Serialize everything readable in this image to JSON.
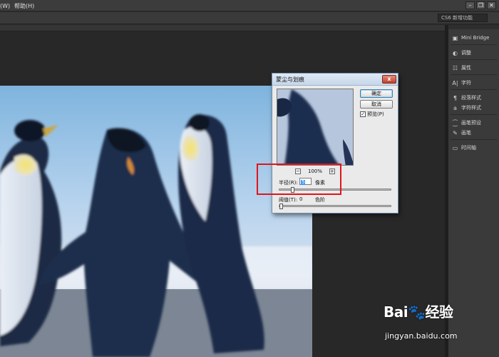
{
  "menubar": {
    "items": [
      "窗口(W)",
      "帮助(H)"
    ],
    "window_buttons": [
      "–",
      "❐",
      "✕"
    ]
  },
  "optbar": {
    "workspace": "CS6 新增功能"
  },
  "panel": {
    "items": [
      {
        "label": "Mini Bridge",
        "icon": "mini-bridge-icon"
      },
      {
        "label": "调整",
        "icon": "adjustments-icon"
      },
      {
        "label": "属性",
        "icon": "properties-icon"
      },
      {
        "label": "字符",
        "icon": "character-icon"
      },
      {
        "label": "段落样式",
        "icon": "paragraph-styles-icon"
      },
      {
        "label": "字符样式",
        "icon": "character-styles-icon"
      },
      {
        "label": "画笔预设",
        "icon": "brush-presets-icon"
      },
      {
        "label": "画笔",
        "icon": "brush-icon"
      },
      {
        "label": "时间轴",
        "icon": "timeline-icon"
      }
    ]
  },
  "dialog": {
    "title": "蒙尘与划痕",
    "close": "x",
    "ok": "确定",
    "cancel": "取消",
    "preview_label": "预览(P)",
    "preview_checked": true,
    "zoom_minus": "−",
    "zoom_plus": "+",
    "zoom": "100%",
    "radius_label": "半径(R):",
    "radius_value": "5",
    "radius_unit": "像素",
    "radius_slider_fraction": 0.05,
    "threshold_label": "阈值(T):",
    "threshold_value": "0",
    "threshold_unit": "色阶",
    "threshold_slider_fraction": 0.0
  },
  "watermark": {
    "brand": "Bai🐾经验",
    "url": "jingyan.baidu.com"
  },
  "colors": {
    "highlight": "#e0151b",
    "dialog_title": "#c6d7ea",
    "close_button": "#c4402c",
    "ui_dark": "#2b2b2b"
  }
}
